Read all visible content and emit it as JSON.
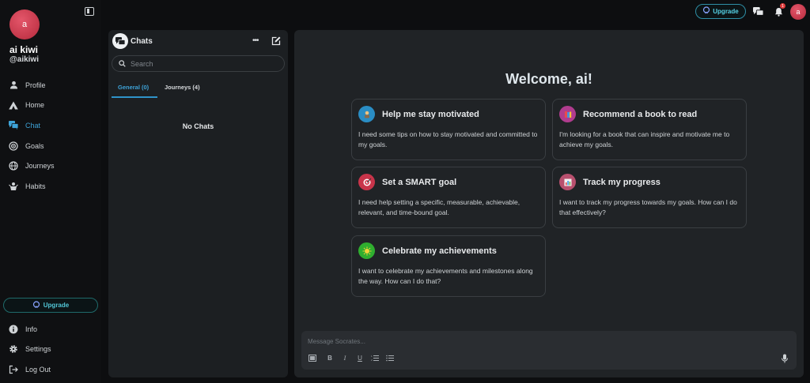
{
  "user": {
    "avatar_letter": "a",
    "name": "ai kiwi",
    "handle": "@aikiwi"
  },
  "sidebar": {
    "items": [
      {
        "label": "Profile",
        "icon": "person-icon"
      },
      {
        "label": "Home",
        "icon": "home-triangle-icon"
      },
      {
        "label": "Chat",
        "icon": "chat-bubbles-icon",
        "active": true
      },
      {
        "label": "Goals",
        "icon": "target-icon"
      },
      {
        "label": "Journeys",
        "icon": "globe-icon"
      },
      {
        "label": "Habits",
        "icon": "habits-icon"
      }
    ],
    "upgrade_label": "Upgrade",
    "bottom_items": [
      {
        "label": "Info",
        "icon": "info-icon"
      },
      {
        "label": "Settings",
        "icon": "gear-icon"
      },
      {
        "label": "Log Out",
        "icon": "logout-icon"
      }
    ]
  },
  "topbar": {
    "upgrade_label": "Upgrade",
    "notification_count": "1",
    "avatar_letter": "a"
  },
  "chats": {
    "title": "Chats",
    "search_placeholder": "Search",
    "tabs": [
      {
        "label": "General (0)",
        "active": true
      },
      {
        "label": "Journeys (4)",
        "active": false
      }
    ],
    "empty_text": "No Chats"
  },
  "main": {
    "welcome": "Welcome, ai!",
    "cards": [
      {
        "title": "Help me stay motivated",
        "desc": "I need some tips on how to stay motivated and committed to my goals.",
        "icon": "motivation-icon"
      },
      {
        "title": "Recommend a book to read",
        "desc": "I'm looking for a book that can inspire and motivate me to achieve my goals.",
        "icon": "books-icon"
      },
      {
        "title": "Set a SMART goal",
        "desc": "I need help setting a specific, measurable, achievable, relevant, and time-bound goal.",
        "icon": "dart-target-icon"
      },
      {
        "title": "Track my progress",
        "desc": "I want to track my progress towards my goals. How can I do that effectively?",
        "icon": "bar-chart-icon"
      },
      {
        "title": "Celebrate my achievements",
        "desc": "I want to celebrate my achievements and milestones along the way. How can I do that?",
        "icon": "celebration-icon"
      }
    ],
    "composer_placeholder": "Message Socrates...",
    "format_buttons": [
      "image",
      "B",
      "I",
      "U",
      "ol",
      "ul"
    ]
  },
  "colors": {
    "accent": "#3ea3d8",
    "upgrade": "#56d2e6",
    "avatar": "#d9394f",
    "background": "#0d0e10",
    "panel": "#202326"
  }
}
